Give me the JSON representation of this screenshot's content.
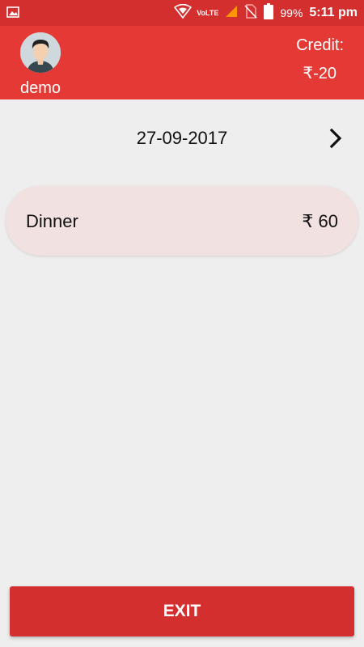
{
  "status_bar": {
    "network_label": "VoLTE",
    "battery_percent": "99%",
    "time": "5:11 pm"
  },
  "header": {
    "username": "demo",
    "credit_label": "Credit:",
    "credit_value": "₹-20"
  },
  "date_nav": {
    "date": "27-09-2017",
    "next_icon": "chevron-right-icon"
  },
  "meals": [
    {
      "name": "Dinner",
      "price": "₹ 60"
    }
  ],
  "footer": {
    "exit_label": "EXIT"
  },
  "colors": {
    "status_bar": "#d32f2f",
    "app_bar": "#e53935",
    "card_bg": "#f1e1e1",
    "button": "#d32f2f"
  }
}
